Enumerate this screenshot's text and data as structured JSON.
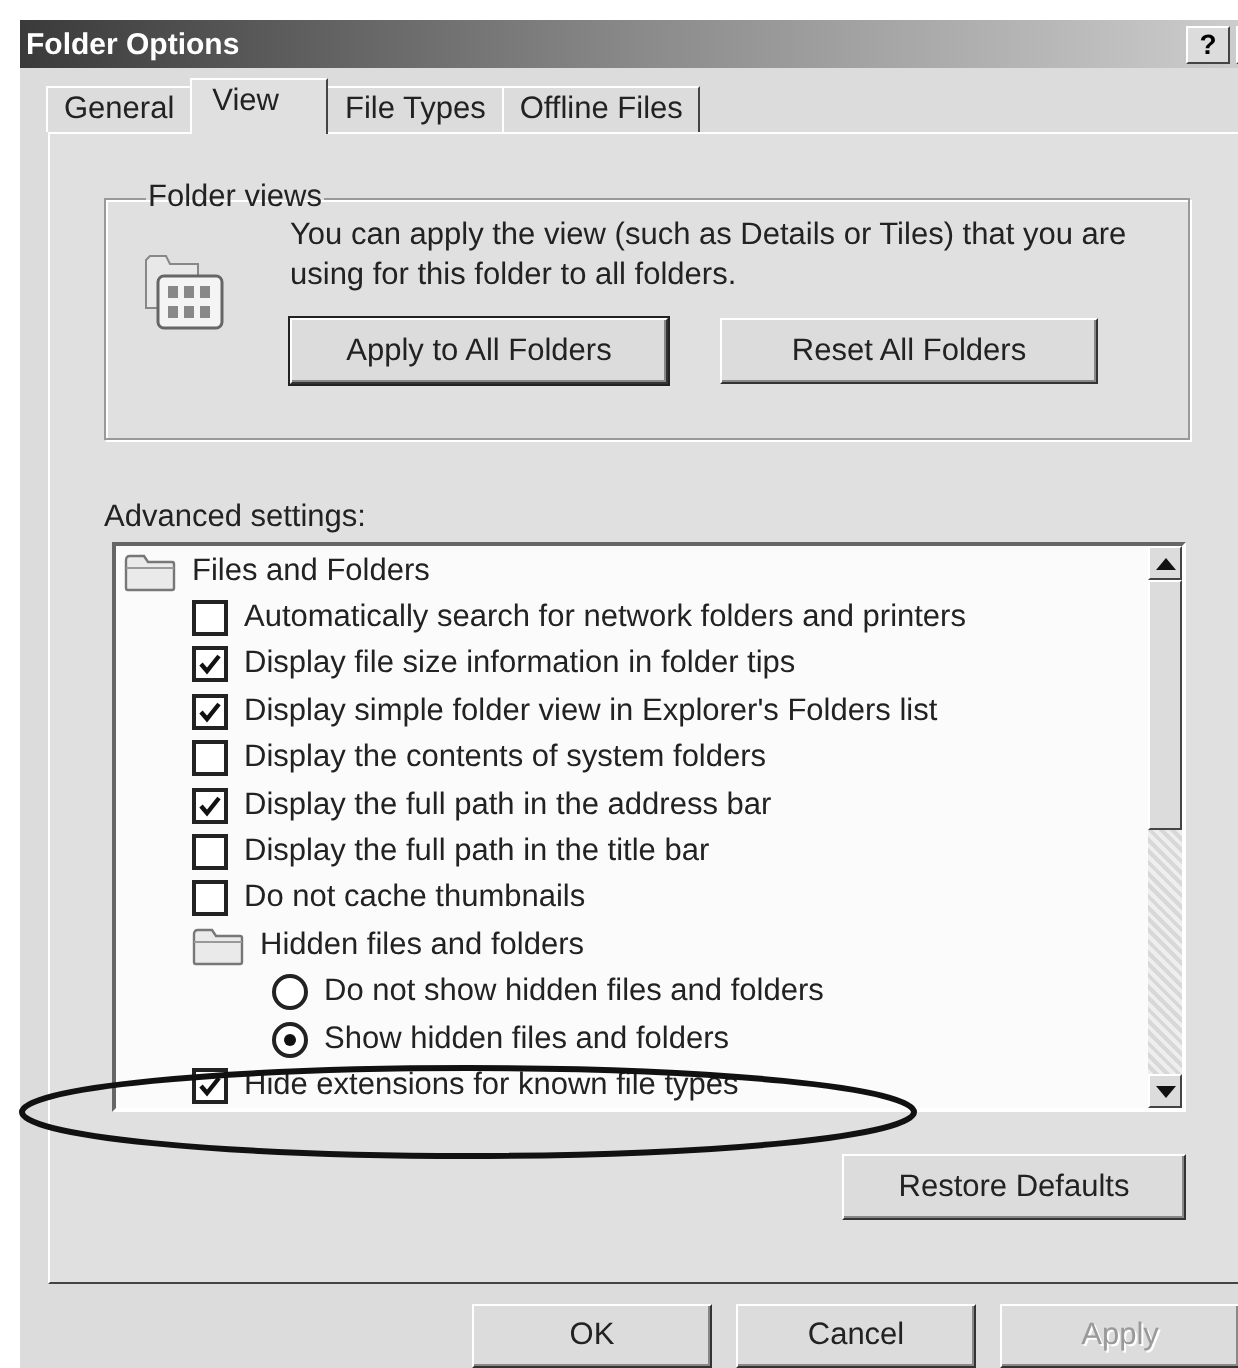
{
  "window": {
    "title": "Folder Options",
    "help": "?"
  },
  "tabs": [
    {
      "label": "General",
      "selected": false
    },
    {
      "label": "View",
      "selected": true
    },
    {
      "label": "File Types",
      "selected": false
    },
    {
      "label": "Offline Files",
      "selected": false
    }
  ],
  "folder_views": {
    "title": "Folder views",
    "description": "You can apply the view (such as Details or Tiles) that you are using for this folder to all folders.",
    "buttons": [
      "Apply to All Folders",
      "Reset All Folders"
    ]
  },
  "advanced_settings": {
    "label": "Advanced settings:",
    "items": [
      {
        "kind": "group",
        "label": "Files and Folders",
        "children": [
          {
            "kind": "checkbox",
            "label": "Automatically search for network folders and printers",
            "checked": false
          },
          {
            "kind": "checkbox",
            "label": "Display file size information in folder tips",
            "checked": true
          },
          {
            "kind": "checkbox",
            "label": "Display simple folder view in Explorer's Folders list",
            "checked": true
          },
          {
            "kind": "checkbox",
            "label": "Display the contents of system folders",
            "checked": false
          },
          {
            "kind": "checkbox",
            "label": "Display the full path in the address bar",
            "checked": true
          },
          {
            "kind": "checkbox",
            "label": "Display the full path in the title bar",
            "checked": false
          },
          {
            "kind": "checkbox",
            "label": "Do not cache thumbnails",
            "checked": false
          },
          {
            "kind": "group",
            "label": "Hidden files and folders",
            "children": [
              {
                "kind": "radio",
                "label": "Do not show hidden files and folders",
                "selected": false
              },
              {
                "kind": "radio",
                "label": "Show hidden files and folders",
                "selected": true
              }
            ]
          },
          {
            "kind": "checkbox",
            "label": "Hide extensions for known file types",
            "checked": true
          }
        ]
      }
    ]
  },
  "restore_button": "Restore Defaults",
  "buttons": [
    {
      "label": "OK",
      "disabled": false
    },
    {
      "label": "Cancel",
      "disabled": false
    },
    {
      "label": "Apply",
      "disabled": true
    }
  ]
}
